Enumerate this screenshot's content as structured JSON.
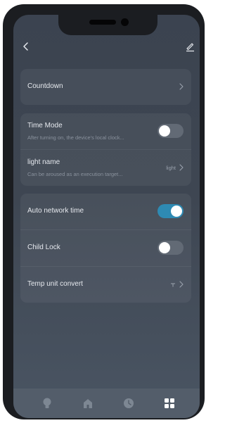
{
  "topbar": {
    "back_icon": "chevron-left-icon",
    "edit_icon": "pencil-icon"
  },
  "sections": {
    "countdown": {
      "label": "Countdown"
    },
    "time_mode": {
      "label": "Time Mode",
      "description": "After turning on, the device's local clock...",
      "enabled": false
    },
    "light_name": {
      "label": "light name",
      "description": "Can be aroused as an execution target...",
      "value": "light"
    },
    "auto_network_time": {
      "label": "Auto network time",
      "enabled": true
    },
    "child_lock": {
      "label": "Child Lock",
      "enabled": false
    },
    "temp_unit_convert": {
      "label": "Temp unit convert",
      "value_icon": "temperature-unit-icon"
    }
  },
  "tabbar": {
    "tabs": [
      {
        "icon": "lightbulb-icon",
        "active": false
      },
      {
        "icon": "home-icon",
        "active": false
      },
      {
        "icon": "clock-icon",
        "active": false
      },
      {
        "icon": "grid-icon",
        "active": true
      }
    ]
  },
  "colors": {
    "background": "#3e4652",
    "card": "#474f5b",
    "toggle_on": "#2e8ab3",
    "toggle_off": "#626a75",
    "text_primary": "#e6e9ee",
    "text_secondary": "#8a929d"
  }
}
